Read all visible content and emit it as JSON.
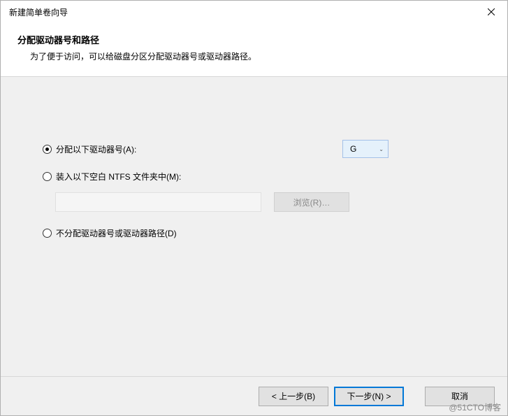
{
  "window": {
    "title": "新建简单卷向导"
  },
  "header": {
    "title": "分配驱动器号和路径",
    "subtitle": "为了便于访问，可以给磁盘分区分配驱动器号或驱动器路径。"
  },
  "options": {
    "assign_letter": {
      "label": "分配以下驱动器号(A):",
      "selected": "G"
    },
    "mount_folder": {
      "label": "装入以下空白 NTFS 文件夹中(M):",
      "path": "",
      "browse_label": "浏览(R)…"
    },
    "no_assign": {
      "label": "不分配驱动器号或驱动器路径(D)"
    }
  },
  "footer": {
    "back": "< 上一步(B)",
    "next": "下一步(N) >",
    "cancel": "取消"
  },
  "watermark": "@51CTO博客"
}
